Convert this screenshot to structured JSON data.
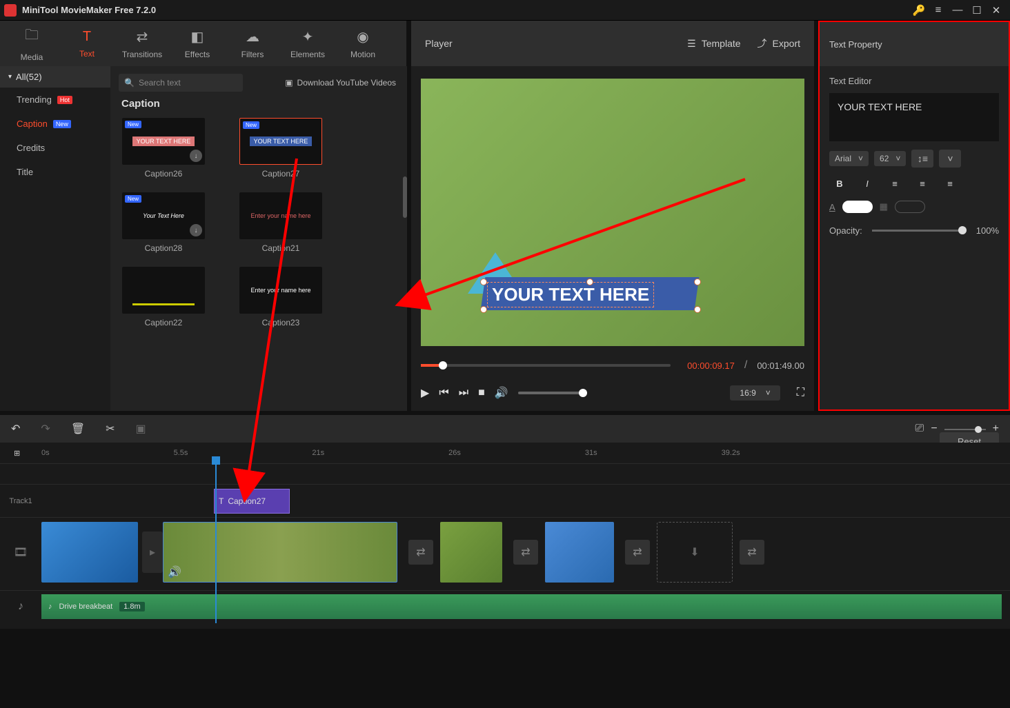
{
  "app": {
    "title": "MiniTool MovieMaker Free 7.2.0"
  },
  "topTabs": {
    "media": "Media",
    "text": "Text",
    "transitions": "Transitions",
    "effects": "Effects",
    "filters": "Filters",
    "elements": "Elements",
    "motion": "Motion"
  },
  "player": {
    "label": "Player",
    "template": "Template",
    "export": "Export"
  },
  "rightHead": "Text Property",
  "sidebar": {
    "all": "All(52)",
    "items": [
      {
        "label": "Trending",
        "badge": "Hot"
      },
      {
        "label": "Caption",
        "badge": "New",
        "active": true
      },
      {
        "label": "Credits"
      },
      {
        "label": "Title"
      }
    ]
  },
  "browser": {
    "searchPlaceholder": "Search text",
    "youtube": "Download YouTube Videos",
    "section": "Caption",
    "items": [
      {
        "label": "Caption26",
        "new": true,
        "dl": true,
        "text": "YOUR TEXT HERE"
      },
      {
        "label": "Caption27",
        "new": true,
        "sel": true,
        "text": "YOUR TEXT HERE"
      },
      {
        "label": "Caption28",
        "new": true,
        "dl": true,
        "text": "Your Text Here"
      },
      {
        "label": "Caption21",
        "text": "Enter your name here"
      },
      {
        "label": "Caption22",
        "text": ""
      },
      {
        "label": "Caption23",
        "text": "Enter your name here"
      }
    ]
  },
  "preview": {
    "overlayText": "YOUR TEXT HERE",
    "current": "00:00:09.17",
    "total": "00:01:49.00",
    "ratio": "16:9"
  },
  "textEditor": {
    "label": "Text Editor",
    "value": "YOUR TEXT HERE",
    "font": "Arial",
    "size": "62",
    "opacityLabel": "Opacity:",
    "opacityValue": "100%",
    "reset": "Reset"
  },
  "ruler": {
    "t0": "0s",
    "t1": "5.5s",
    "t2": "21s",
    "t3": "26s",
    "t4": "31s",
    "t5": "39.2s"
  },
  "tracks": {
    "track1": "Track1",
    "textClip": "Caption27",
    "audio": {
      "name": "Drive breakbeat",
      "dur": "1.8m"
    }
  }
}
